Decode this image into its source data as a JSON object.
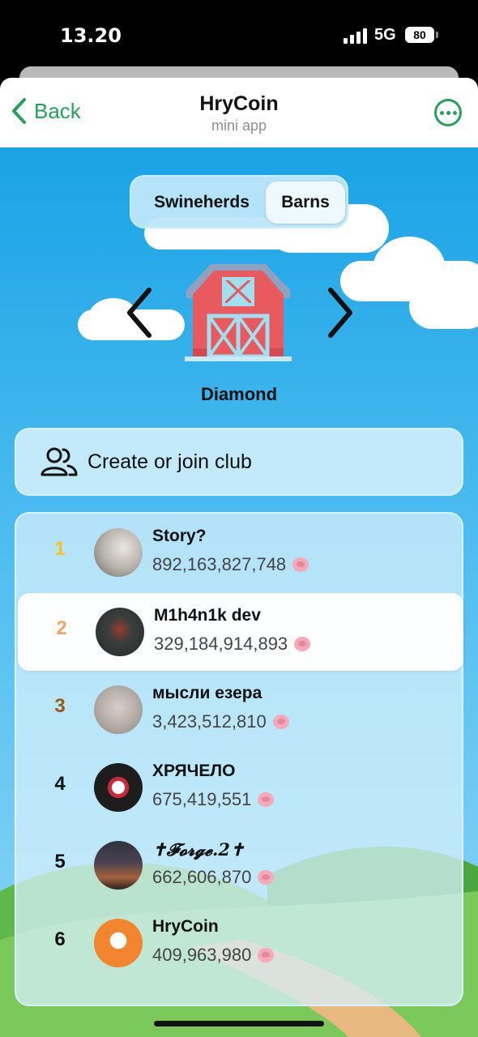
{
  "status_bar": {
    "time": "13.20",
    "network": "5G",
    "battery": "80"
  },
  "header": {
    "back_label": "Back",
    "title": "HryCoin",
    "subtitle": "mini app"
  },
  "tabs": [
    {
      "label": "Swineherds",
      "selected": false
    },
    {
      "label": "Barns",
      "selected": true
    }
  ],
  "league": {
    "name": "Diamond"
  },
  "club_button": {
    "label": "Create or join club"
  },
  "leaderboard": [
    {
      "rank": "1",
      "name": "Story?",
      "score": "892,163,827,748",
      "rank_color": "#f2c518"
    },
    {
      "rank": "2",
      "name": "M1h4n1k dev",
      "score": "329,184,914,893",
      "rank_color": "#f0a86a"
    },
    {
      "rank": "3",
      "name": "мысли езера",
      "score": "3,423,512,810",
      "rank_color": "#9a5b12"
    },
    {
      "rank": "4",
      "name": "ХРЯЧЕЛО",
      "score": "675,419,551",
      "rank_color": "#111111"
    },
    {
      "rank": "5",
      "name": "✝𝓕𝓸𝓻𝓰𝓮.2✝",
      "score": "662,606,870",
      "rank_color": "#111111"
    },
    {
      "rank": "6",
      "name": "HryCoin",
      "score": "409,963,980",
      "rank_color": "#111111"
    }
  ],
  "colors": {
    "accent": "#27a05b",
    "sky": "#1aa3e6",
    "barn_red": "#e85a5e"
  }
}
